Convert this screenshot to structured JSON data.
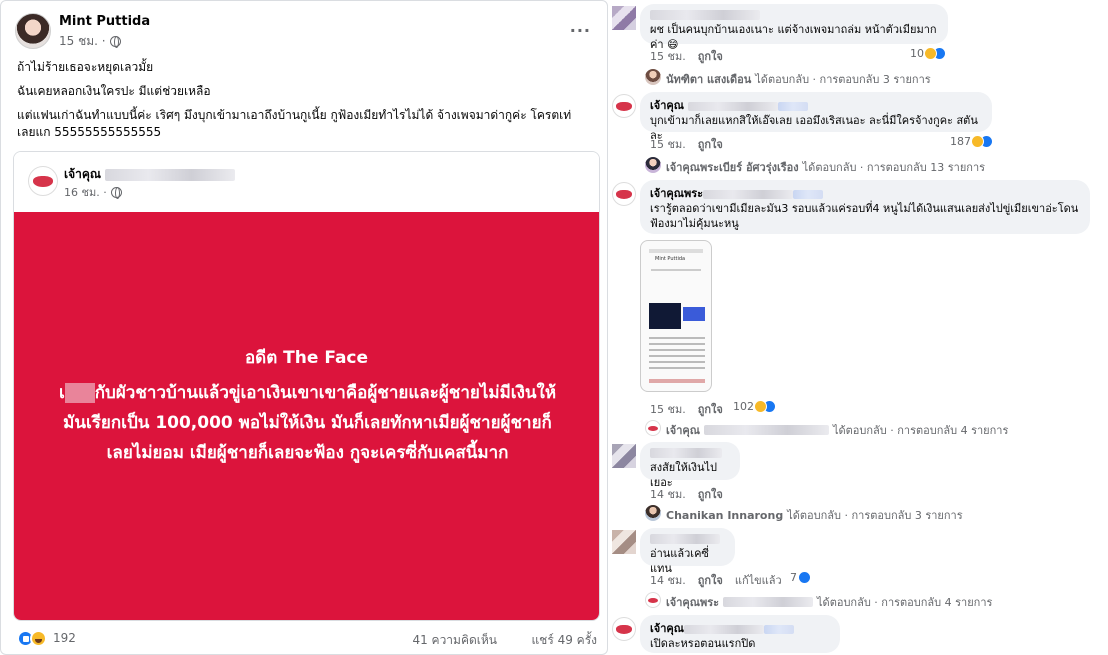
{
  "post": {
    "author": "Mint Puttida",
    "time": "15 ชม. ·",
    "more": "···",
    "text": [
      "ถ้าไม่ร้ายเธอจะหยุดเลวมั้ย",
      "ฉันเคยหลอกเงินใครปะ มีแต่ช่วยเหลือ",
      "แต่แฟนเก่าฉันทำแบบนี้ค่ะ เริศๆ มึงบุกเข้ามาเอาถึงบ้านกูเนี้ย กูฟ้องเมียทำไรไม่ได้ จ้างเพจมาด่ากูค่ะ โครตเท่",
      "เลยแก 55555555555555"
    ],
    "shared": {
      "author": "เจ้าคุณ",
      "time": "16 ชม. ·",
      "title": "อดีต The Face",
      "body_prefix": "เ",
      "body": "กับผัวชาวบ้านแล้วขู่เอาเงินเขาเขาคือผู้ชายและผู้ชายไม่มีเงินให้มันเรียกเป็น 100,000 พอไม่ให้เงิน มันก็เลยทักหาเมียผู้ชายผู้ชายก็เลยไม่ยอม เมียผู้ชายก็เลยจะฟ้อง กูจะเครซี่กับเคสนี้มาก",
      "bg_color": "#dc143c"
    },
    "reactions": "192",
    "comments": "41 ความคิดเห็น",
    "shares": "แชร์ 49 ครั้ง"
  },
  "comments": [
    {
      "text": "ผช เป็นคนบุกบ้านเองเนาะ แต่จ้างเพจมาถล่ม หน้าตัวเมียมากค่า 😄",
      "time": "15 ชม.",
      "like": "ถูกใจ",
      "react_count": "10",
      "reply_by": "นัทฑิตา แสงเดือน",
      "reply_text": "ได้ตอบกลับ · การตอบกลับ 3 รายการ"
    },
    {
      "name": "เจ้าคุณ",
      "text": "บุกเข้ามาก็เลยแหกสิให้เอ๊จเลย เออมึงเริสเนอะ ละนี่มีใครจ้างกูคะ สตันละ",
      "time": "15 ชม.",
      "like": "ถูกใจ",
      "react_count": "187",
      "reply_by": "เจ้าคุณพระเบียร์ อัศวรุ่งเรือง",
      "reply_text": "ได้ตอบกลับ · การตอบกลับ 13 รายการ"
    },
    {
      "name": "เจ้าคุณพระ",
      "text": "เรารู้ตลอดว่าเขามีเมียละมัน3 รอบแล้วแค่รอบที่4 หนูไม่ได้เงินแสนเลยส่งไปขู่เมียเขาอ่ะโดนฟ้องมาไม่คุ้มนะหนู",
      "thumb_title": "Mint Puttida",
      "time": "15 ชม.",
      "like": "ถูกใจ",
      "react_count": "102",
      "reply_by": "เจ้าคุณ",
      "reply_text": "ได้ตอบกลับ · การตอบกลับ 4 รายการ"
    },
    {
      "text": "สงสัยให้เงินไปเยอะ",
      "time": "14 ชม.",
      "like": "ถูกใจ",
      "reply_by": "Chanikan Innarong",
      "reply_text": "ได้ตอบกลับ · การตอบกลับ 3 รายการ"
    },
    {
      "text": "อ่านแล้วเคซี่แทน",
      "time": "14 ชม.",
      "like": "ถูกใจ",
      "edited": "แก้ไขแล้ว",
      "react_count": "7",
      "reply_by": "เจ้าคุณพระ",
      "reply_text": "ได้ตอบกลับ · การตอบกลับ 4 รายการ"
    },
    {
      "name": "เจ้าคุณ",
      "text": "เปิดละหรอตอนแรกปิด"
    }
  ]
}
